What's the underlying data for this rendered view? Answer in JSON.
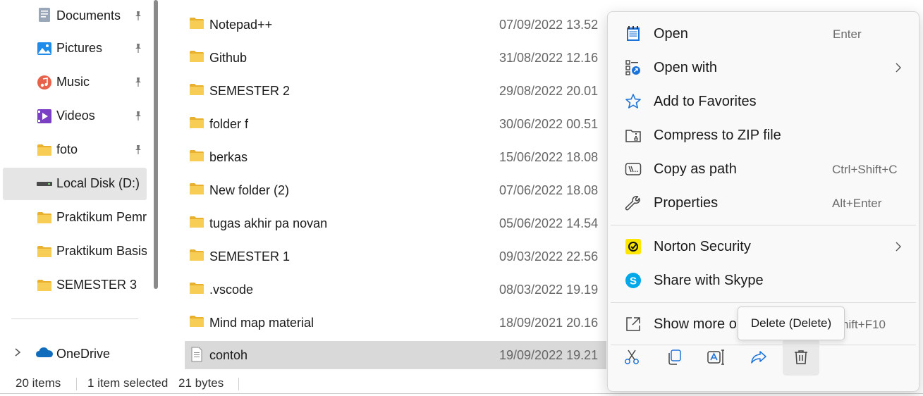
{
  "sidebar": {
    "items": [
      {
        "label": "Documents",
        "icon": "documents-icon",
        "pinned": true
      },
      {
        "label": "Pictures",
        "icon": "pictures-icon",
        "pinned": true
      },
      {
        "label": "Music",
        "icon": "music-icon",
        "pinned": true
      },
      {
        "label": "Videos",
        "icon": "videos-icon",
        "pinned": true
      },
      {
        "label": "foto",
        "icon": "folder-icon",
        "pinned": true
      },
      {
        "label": "Local Disk (D:)",
        "icon": "drive-icon",
        "pinned": false,
        "selected": true
      },
      {
        "label": "Praktikum Pemrograman",
        "icon": "folder-icon",
        "pinned": false
      },
      {
        "label": "Praktikum Basis Data",
        "icon": "folder-icon",
        "pinned": false
      },
      {
        "label": "SEMESTER 3",
        "icon": "folder-icon",
        "pinned": false
      }
    ],
    "onedrive_label": "OneDrive"
  },
  "files": [
    {
      "name": "Notepad++",
      "date": "07/09/2022 13.52",
      "type": "folder"
    },
    {
      "name": "Github",
      "date": "31/08/2022 12.16",
      "type": "folder"
    },
    {
      "name": "SEMESTER 2",
      "date": "29/08/2022 20.01",
      "type": "folder"
    },
    {
      "name": "folder f",
      "date": "30/06/2022 00.51",
      "type": "folder"
    },
    {
      "name": "berkas",
      "date": "15/06/2022 18.08",
      "type": "folder"
    },
    {
      "name": "New folder (2)",
      "date": "07/06/2022 18.08",
      "type": "folder"
    },
    {
      "name": "tugas akhir pa novan",
      "date": "05/06/2022 14.54",
      "type": "folder"
    },
    {
      "name": "SEMESTER 1",
      "date": "09/03/2022 22.56",
      "type": "folder"
    },
    {
      "name": ".vscode",
      "date": "08/03/2022 19.19",
      "type": "folder"
    },
    {
      "name": "Mind map material",
      "date": "18/09/2021 20.16",
      "type": "folder"
    },
    {
      "name": "contoh",
      "date": "19/09/2022 19.21",
      "type": "text-file",
      "selected": true
    }
  ],
  "status": {
    "item_count": "20 items",
    "selection": "1 item selected",
    "size": "21 bytes"
  },
  "context_menu": {
    "open": {
      "label": "Open",
      "shortcut": "Enter"
    },
    "open_with": {
      "label": "Open with"
    },
    "favorites": {
      "label": "Add to Favorites"
    },
    "compress": {
      "label": "Compress to ZIP file"
    },
    "copy_path": {
      "label": "Copy as path",
      "shortcut": "Ctrl+Shift+C"
    },
    "properties": {
      "label": "Properties",
      "shortcut": "Alt+Enter"
    },
    "norton": {
      "label": "Norton Security"
    },
    "skype": {
      "label": "Share with Skype"
    },
    "show_more": {
      "label": "Show more o",
      "shortcut": "hift+F10"
    },
    "tooltip": "Delete (Delete)",
    "quick_actions": [
      "cut-icon",
      "copy-icon",
      "rename-icon",
      "share-icon",
      "delete-icon"
    ]
  },
  "colors": {
    "folder": "#f5c542",
    "accent": "#0067c0",
    "selection": "#d9d9d9",
    "norton": "#ffe600",
    "skype": "#00a8e8",
    "onedrive": "#0f6cbd"
  }
}
